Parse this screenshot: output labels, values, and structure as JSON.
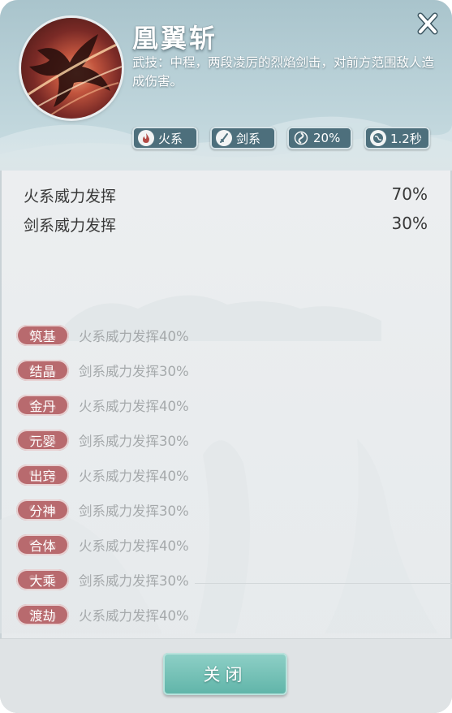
{
  "skill": {
    "name": "凰翼斩",
    "description": "武技：中程，两段凌厉的烈焰剑击，对前方范围敌人造成伤害。"
  },
  "tags": [
    {
      "icon": "fire-icon",
      "label": "火系"
    },
    {
      "icon": "sword-icon",
      "label": "剑系"
    },
    {
      "icon": "swirl-icon",
      "label": "20%"
    },
    {
      "icon": "globe-icon",
      "label": "1.2秒"
    }
  ],
  "stats": [
    {
      "label": "火系威力发挥",
      "value": "70%"
    },
    {
      "label": "剑系威力发挥",
      "value": "30%"
    }
  ],
  "realms": [
    {
      "badge": "筑基",
      "text": "火系威力发挥40%"
    },
    {
      "badge": "结晶",
      "text": "剑系威力发挥30%"
    },
    {
      "badge": "金丹",
      "text": "火系威力发挥40%"
    },
    {
      "badge": "元婴",
      "text": "剑系威力发挥30%"
    },
    {
      "badge": "出窍",
      "text": "火系威力发挥40%"
    },
    {
      "badge": "分神",
      "text": "剑系威力发挥30%"
    },
    {
      "badge": "合体",
      "text": "火系威力发挥40%"
    },
    {
      "badge": "大乘",
      "text": "剑系威力发挥30%"
    },
    {
      "badge": "渡劫",
      "text": "火系威力发挥40%"
    }
  ],
  "footer": {
    "close_label": "关闭"
  },
  "colors": {
    "header": "#a9c4cc",
    "tag_bg": "#4d6f7c",
    "realm_badge": "#b86a6e",
    "close_button": "#5fb4a8"
  }
}
